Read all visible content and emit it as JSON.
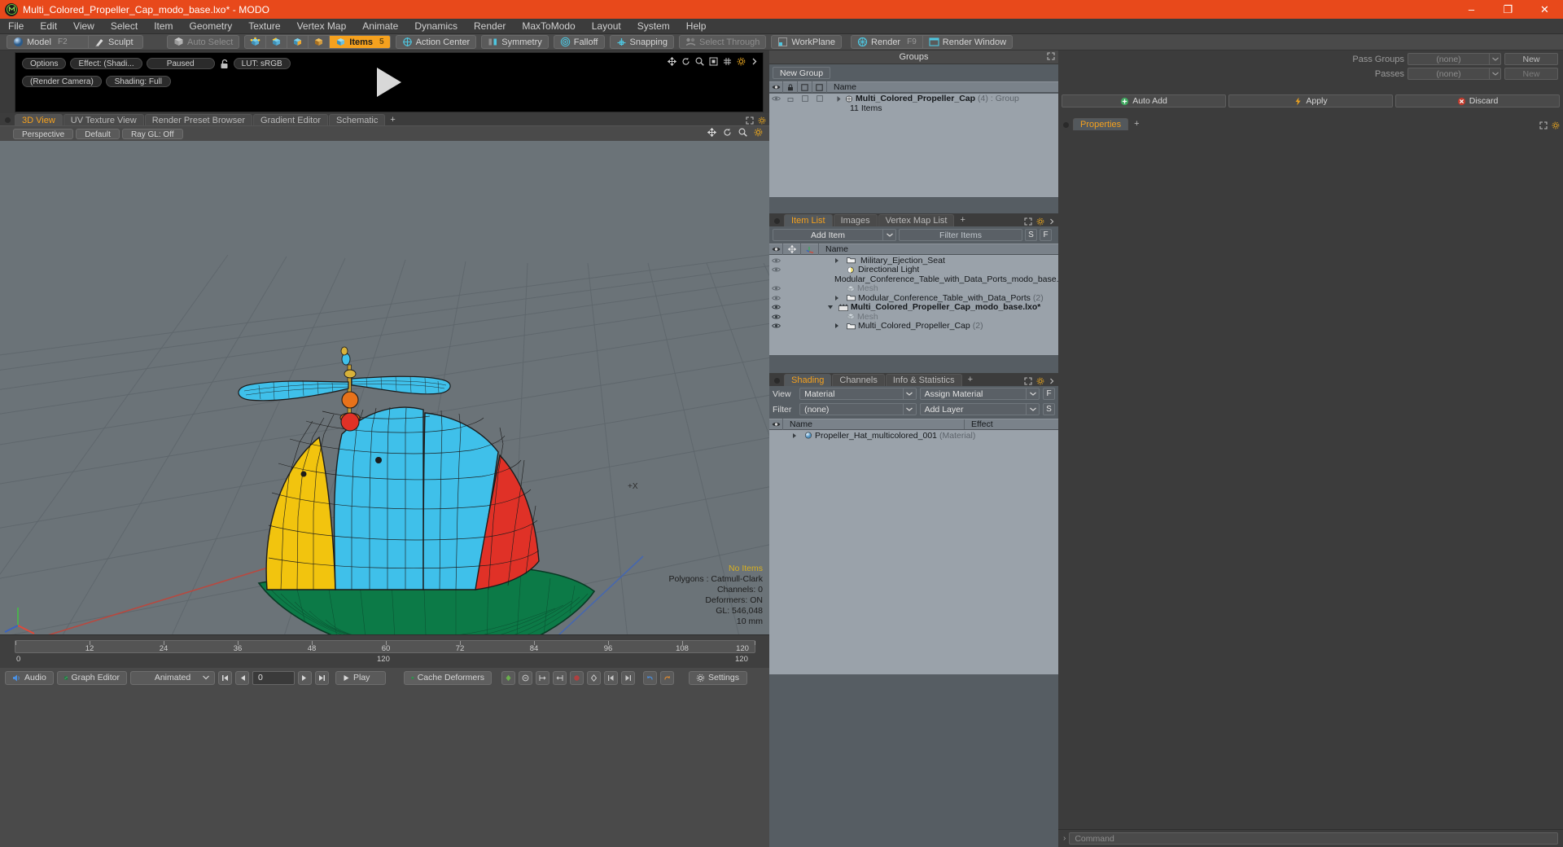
{
  "window": {
    "title": "Multi_Colored_Propeller_Cap_modo_base.lxo* - MODO",
    "app_icon": "modo-logo-icon",
    "buttons": [
      {
        "name": "minimize-button",
        "glyph": "–"
      },
      {
        "name": "maximize-button",
        "glyph": "❐"
      },
      {
        "name": "close-button",
        "glyph": "✕"
      }
    ],
    "titlebar_color": "#e8491b"
  },
  "menubar": {
    "items": [
      "File",
      "Edit",
      "View",
      "Select",
      "Item",
      "Geometry",
      "Texture",
      "Vertex Map",
      "Animate",
      "Dynamics",
      "Render",
      "MaxToModo",
      "Layout",
      "System",
      "Help"
    ]
  },
  "toolbar": {
    "mode_group": [
      {
        "label": "Model",
        "hotkey": "F2",
        "icon": "sphere-icon",
        "state": "normal"
      },
      {
        "label": "Sculpt",
        "hotkey": "",
        "icon": "brush-icon",
        "state": "normal"
      }
    ],
    "select_group": [
      {
        "label": "Auto Select",
        "hotkey": "",
        "icon": "cube-grey-icon",
        "state": "dim"
      }
    ],
    "component_group": [
      {
        "label": "",
        "hotkey": "",
        "icon": "vertex-cube-icon",
        "state": "normal"
      },
      {
        "label": "",
        "hotkey": "",
        "icon": "edge-cube-icon",
        "state": "normal"
      },
      {
        "label": "",
        "hotkey": "",
        "icon": "polygon-cube-icon",
        "state": "normal"
      },
      {
        "label": "",
        "hotkey": "",
        "icon": "material-cube-icon",
        "state": "normal"
      },
      {
        "label": "Items",
        "hotkey": "5",
        "icon": "items-cube-icon",
        "state": "active"
      }
    ],
    "action_group": [
      {
        "label": "Action Center",
        "hotkey": "",
        "icon": "action-center-icon",
        "state": "normal"
      },
      {
        "label": "Symmetry",
        "hotkey": "",
        "icon": "symmetry-icon",
        "state": "normal"
      },
      {
        "label": "Falloff",
        "hotkey": "",
        "icon": "falloff-icon",
        "state": "normal"
      },
      {
        "label": "Snapping",
        "hotkey": "",
        "icon": "snapping-icon",
        "state": "normal"
      },
      {
        "label": "Select Through",
        "hotkey": "",
        "icon": "select-through-icon",
        "state": "dim"
      },
      {
        "label": "WorkPlane",
        "hotkey": "",
        "icon": "workplane-icon",
        "state": "normal"
      }
    ],
    "render_group": [
      {
        "label": "Render",
        "hotkey": "F9",
        "icon": "render-icon",
        "state": "normal"
      },
      {
        "label": "Render Window",
        "hotkey": "",
        "icon": "render-window-icon",
        "state": "normal"
      }
    ]
  },
  "render_preview": {
    "row1": [
      {
        "name": "options-button",
        "label": "Options"
      },
      {
        "name": "effect-button",
        "label": "Effect: (Shadi..."
      },
      {
        "name": "paused-button",
        "label": "Paused"
      },
      {
        "name": "lock-toggle",
        "label": "",
        "icon": "unlocked-padlock-icon"
      },
      {
        "name": "lut-button",
        "label": "LUT: sRGB"
      }
    ],
    "row2": [
      {
        "name": "render-camera-button",
        "label": "(Render Camera)"
      },
      {
        "name": "shading-button",
        "label": "Shading: Full"
      }
    ],
    "tools": [
      "move-icon",
      "rotate-icon",
      "zoom-icon",
      "fit-icon",
      "grid-icon",
      "gear-icon",
      "chevron-right-icon"
    ],
    "play_overlay": "play-triangle-icon"
  },
  "viewport_tabs": {
    "tabs": [
      {
        "label": "3D View",
        "active": true
      },
      {
        "label": "UV Texture View",
        "active": false
      },
      {
        "label": "Render Preset Browser",
        "active": false
      },
      {
        "label": "Gradient Editor",
        "active": false
      },
      {
        "label": "Schematic",
        "active": false
      },
      {
        "label": "+",
        "active": false
      }
    ],
    "controls": [
      "expand-icon",
      "gear-icon"
    ]
  },
  "viewport": {
    "header_buttons": [
      {
        "name": "perspective-button",
        "label": "Perspective"
      },
      {
        "name": "default-button",
        "label": "Default"
      },
      {
        "name": "raygl-button",
        "label": "Ray GL: Off"
      }
    ],
    "header_controls": [
      "move-icon",
      "rotate-icon",
      "zoom-icon",
      "gear-icon"
    ],
    "axis_label": "+X",
    "stats": {
      "selection": "No Items",
      "polygons": "Polygons : Catmull-Clark",
      "channels": "Channels: 0",
      "deformers": "Deformers: ON",
      "gl": "GL: 546,048",
      "grid": "10 mm"
    },
    "bg_color": "#6b7378",
    "grid_color": "#5d656b"
  },
  "timeline": {
    "major_ticks": [
      0,
      12,
      24,
      36,
      48,
      60,
      72,
      84,
      96,
      108,
      120
    ],
    "start_label": "0",
    "center_label": "120",
    "end_label": "120"
  },
  "bottombar": {
    "buttons": [
      {
        "name": "audio-button",
        "label": "Audio",
        "icon": "audio-icon"
      },
      {
        "name": "graph-editor-button",
        "label": "Graph Editor",
        "icon": "graph-icon"
      },
      {
        "name": "animated-combo",
        "label": "Animated",
        "icon": "chevron-down-icon"
      },
      {
        "name": "frame-field",
        "label": "0"
      },
      {
        "name": "play-button",
        "label": "Play",
        "icon": "play-icon"
      },
      {
        "name": "cache-deformers-button",
        "label": "Cache Deformers",
        "icon": "cache-icon"
      },
      {
        "name": "settings-button",
        "label": "Settings",
        "icon": "gear-icon"
      }
    ],
    "transport": [
      "skip-start-icon",
      "step-back-icon",
      "step-forward-icon",
      "skip-end-icon"
    ],
    "toggles": [
      "key-icon",
      "autokey-icon",
      "range-start-icon",
      "range-end-icon",
      "record-icon",
      "key-all-icon",
      "prev-key-icon",
      "next-key-icon",
      "undo-key-icon",
      "redo-key-icon"
    ]
  },
  "groups_panel": {
    "title": "Groups",
    "new_group_button": "New Group",
    "columns": [
      "eye",
      "lock",
      "render",
      "select",
      "Name"
    ],
    "rows": [
      {
        "name": "Multi_Colored_Propeller_Cap",
        "count": "(4)",
        "suffix": ": Group",
        "sub": "11 Items",
        "icon": "group-icon",
        "expanded": false
      }
    ],
    "controls": [
      "expand-icon"
    ]
  },
  "item_list_panel": {
    "tabs": [
      {
        "label": "Item List",
        "active": true
      },
      {
        "label": "Images",
        "active": false
      },
      {
        "label": "Vertex Map List",
        "active": false
      },
      {
        "label": "+",
        "active": false
      }
    ],
    "add_item_label": "Add Item",
    "filter_placeholder": "Filter Items",
    "filter_buttons": [
      "S",
      "F"
    ],
    "columns": [
      "eye",
      "move",
      "axis",
      "Name"
    ],
    "rows": [
      {
        "label": "Military_Ejection_Seat",
        "icon": "folder-icon",
        "indent": 2,
        "eye": true,
        "arrow": "right",
        "bold": false,
        "count": "",
        "dim": false
      },
      {
        "label": "Directional Light",
        "icon": "light-icon",
        "indent": 2,
        "eye": true,
        "arrow": "none",
        "bold": false,
        "count": "",
        "dim": false
      },
      {
        "label": "Modular_Conference_Table_with_Data_Ports_modo_base....",
        "icon": "scene-icon",
        "indent": 1,
        "eye": false,
        "arrow": "down",
        "bold": false,
        "count": "",
        "dim": false
      },
      {
        "label": "Mesh",
        "icon": "mesh-icon",
        "indent": 2,
        "eye": true,
        "arrow": "none",
        "bold": false,
        "count": "",
        "dim": true
      },
      {
        "label": "Modular_Conference_Table_with_Data_Ports",
        "icon": "folder-icon",
        "indent": 2,
        "eye": true,
        "arrow": "right",
        "bold": false,
        "count": "(2)",
        "dim": false
      },
      {
        "label": "Multi_Colored_Propeller_Cap_modo_base.lxo*",
        "icon": "scene-icon",
        "indent": 1,
        "eye": true,
        "arrow": "down",
        "bold": true,
        "count": "",
        "dim": false
      },
      {
        "label": "Mesh",
        "icon": "mesh-icon",
        "indent": 2,
        "eye": true,
        "arrow": "none",
        "bold": false,
        "count": "",
        "dim": true
      },
      {
        "label": "Multi_Colored_Propeller_Cap",
        "icon": "folder-icon",
        "indent": 2,
        "eye": true,
        "arrow": "right",
        "bold": false,
        "count": "(2)",
        "dim": false
      }
    ],
    "controls": [
      "expand-icon",
      "gear-icon",
      "chevron-right-icon"
    ]
  },
  "shading_panel": {
    "tabs": [
      {
        "label": "Shading",
        "active": true
      },
      {
        "label": "Channels",
        "active": false
      },
      {
        "label": "Info & Statistics",
        "active": false
      },
      {
        "label": "+",
        "active": false
      }
    ],
    "view_label": "View",
    "view_value": "Material",
    "assign_material_label": "Assign Material",
    "assign_suffix": "F",
    "filter_label": "Filter",
    "filter_value": "(none)",
    "add_layer_label": "Add Layer",
    "add_layer_suffix": "S",
    "columns": [
      "eye",
      "Name",
      "Effect"
    ],
    "rows": [
      {
        "name": "Propeller_Hat_multicolored_001",
        "type": "(Material)",
        "icon": "material-sphere-icon",
        "effect": "",
        "arrow": "right"
      }
    ],
    "controls": [
      "expand-icon",
      "gear-icon",
      "chevron-right-icon"
    ]
  },
  "passes_panel": {
    "rows": [
      {
        "label": "Pass Groups",
        "combo": "(none)",
        "button": "New",
        "dim": false
      },
      {
        "label": "Passes",
        "combo": "(none)",
        "button": "New",
        "dim": true
      }
    ],
    "actions": [
      {
        "label": "Auto Add",
        "icon": "plus-circle-icon"
      },
      {
        "label": "Apply",
        "icon": "lightning-icon"
      },
      {
        "label": "Discard",
        "icon": "x-circle-icon"
      }
    ]
  },
  "properties_panel": {
    "tabs": [
      {
        "label": "Properties",
        "active": true
      },
      {
        "label": "+",
        "active": false
      }
    ],
    "controls": [
      "expand-icon",
      "gear-icon"
    ]
  },
  "command_bar": {
    "chevron": "›",
    "placeholder": "Command"
  }
}
